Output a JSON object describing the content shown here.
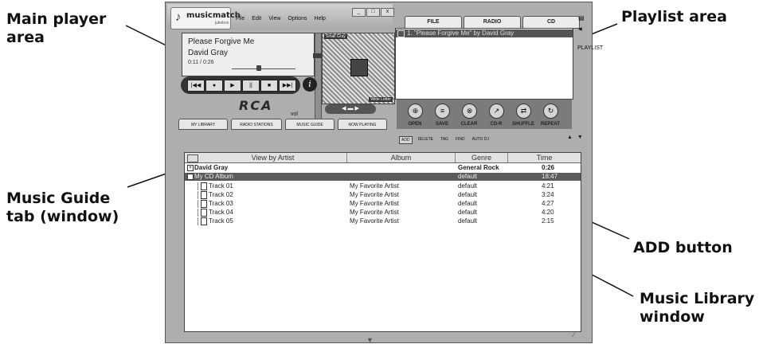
{
  "callouts": {
    "main_player": "Main player\narea",
    "playlist_area": "Playlist area",
    "music_guide": "Music Guide\ntab (window)",
    "add_button": "ADD button",
    "music_library": "Music Library\nwindow"
  },
  "app": {
    "logo": "musicmatch",
    "logo_sub": "jukebox",
    "menu": [
      "File",
      "Edit",
      "View",
      "Options",
      "Help"
    ],
    "window_buttons": [
      "_",
      "□",
      "x"
    ]
  },
  "player": {
    "track_title": "Please Forgive Me",
    "artist": "David Gray",
    "time": "0:11 / 0:26",
    "transport": [
      "|◀◀",
      "●",
      "▶",
      "||",
      "■",
      "▶▶|"
    ],
    "info_glyph": "i",
    "brand": "RCA",
    "vol_label": "vol",
    "viz_label": "Small Gray",
    "viz_label2": "Wide Letter",
    "viz_controls": "◀ ▬ ▶",
    "volume_level": 0.75,
    "seek_position": 0.42
  },
  "tabs": [
    "MY LIBRARY",
    "RADIO STATIONS",
    "MUSIC GUIDE",
    "NOW PLAYING"
  ],
  "playlist": {
    "tabs": [
      "FILE",
      "RADIO",
      "CD"
    ],
    "entry": "1. \"Please Forgive Me\" by David Gray",
    "side_label": "PLAYLIST",
    "buttons": [
      {
        "glyph": "⊕",
        "label": "OPEN"
      },
      {
        "glyph": "≡",
        "label": "SAVE"
      },
      {
        "glyph": "⊗",
        "label": "CLEAR"
      },
      {
        "glyph": "↗",
        "label": "CD-R"
      },
      {
        "glyph": "⇄",
        "label": "SHUFFLE"
      },
      {
        "glyph": "↻",
        "label": "REPEAT"
      }
    ]
  },
  "library": {
    "toolbar": [
      "ADD",
      "DELETE",
      "TAG",
      "FIND",
      "AUTO DJ"
    ],
    "scroll_arrows": "▲ ▼",
    "columns": [
      "View by Artist",
      "Album",
      "Genre",
      "Time"
    ],
    "rows": [
      {
        "name": "David Gray",
        "album": "",
        "genre": "General Rock",
        "time": "0:26"
      },
      {
        "name": "My CD Album",
        "album": "",
        "genre": "default",
        "time": "18:47"
      },
      {
        "name": "Track 01",
        "album": "My Favorite Artist",
        "genre": "default",
        "time": "4:21"
      },
      {
        "name": "Track 02",
        "album": "My Favorite Artist",
        "genre": "default",
        "time": "3:24"
      },
      {
        "name": "Track 03",
        "album": "My Favorite Artist",
        "genre": "default",
        "time": "4:27"
      },
      {
        "name": "Track 04",
        "album": "My Favorite Artist",
        "genre": "default",
        "time": "4:20"
      },
      {
        "name": "Track 05",
        "album": "My Favorite Artist",
        "genre": "default",
        "time": "2:15"
      }
    ]
  },
  "colors": {
    "selection": "#5b5b5b",
    "chrome": "#aeaeae",
    "callout_text": "#111111"
  }
}
